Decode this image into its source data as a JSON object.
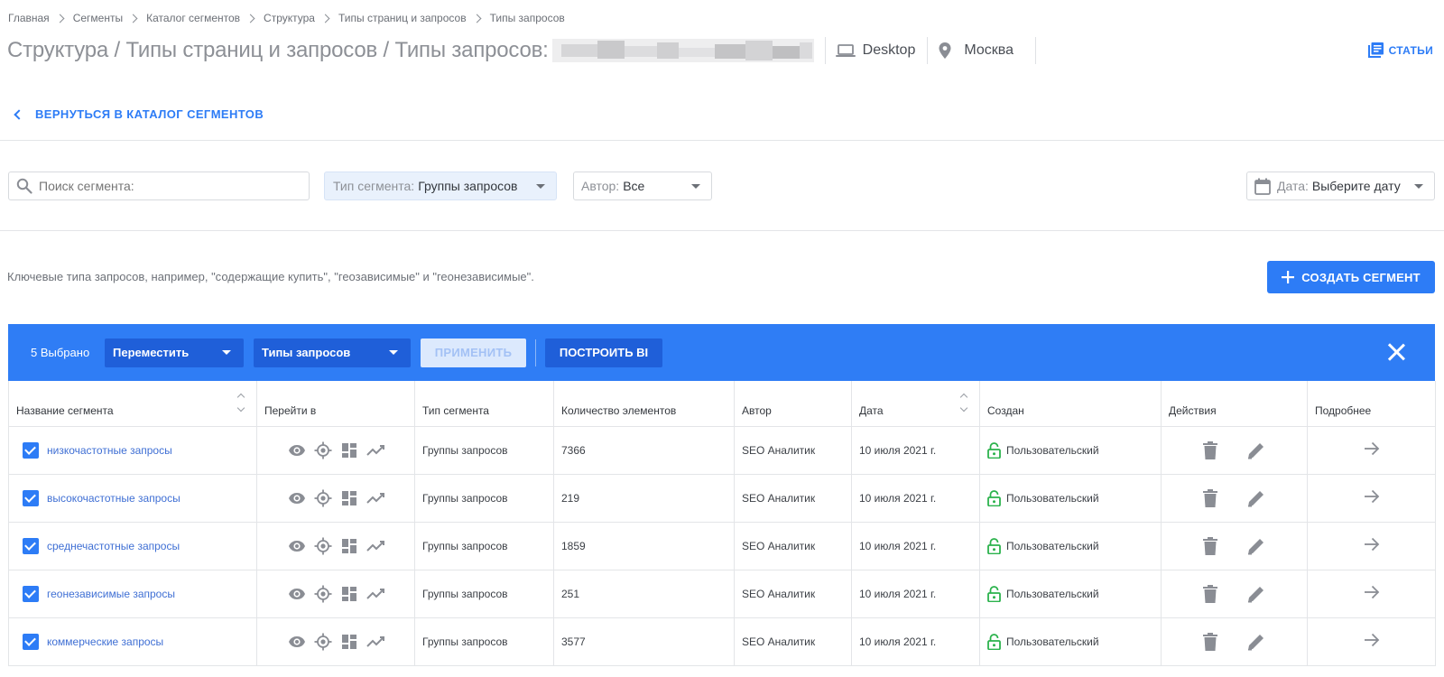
{
  "breadcrumb": [
    "Главная",
    "Сегменты",
    "Каталог сегментов",
    "Структура",
    "Типы страниц и запросов",
    "Типы запросов"
  ],
  "header": {
    "title": "Структура / Типы страниц и запросов / Типы запросов:",
    "device": "Desktop",
    "region": "Москва",
    "articles_label": "СТАТЬИ"
  },
  "back_link": "ВЕРНУТЬСЯ В КАТАЛОГ СЕГМЕНТОВ",
  "filters": {
    "search_placeholder": "Поиск сегмента:",
    "segment_type_label": "Тип сегмента:",
    "segment_type_value": "Группы запросов",
    "author_label": "Автор:",
    "author_value": "Все",
    "date_label": "Дата:",
    "date_value": "Выберите дату"
  },
  "description": "Ключевые типа запросов, например, \"содержащие купить\", \"геозависимые\" и \"геонезависимые\".",
  "create_button": "СОЗДАТЬ СЕГМЕНТ",
  "bulk": {
    "selected_count": "5 Выбрано",
    "action_value": "Переместить",
    "target_value": "Типы запросов",
    "apply_label": "ПРИМЕНИТЬ",
    "build_bi_label": "ПОСТРОИТЬ BI"
  },
  "table": {
    "headers": {
      "name": "Название сегмента",
      "goto": "Перейти в",
      "type": "Тип сегмента",
      "count": "Количество элементов",
      "author": "Автор",
      "date": "Дата",
      "created": "Создан",
      "actions": "Действия",
      "details": "Подробнее"
    },
    "rows": [
      {
        "name": "низкочастотные запросы",
        "type": "Группы запросов",
        "count": "7366",
        "author": "SEO Аналитик",
        "date": "10 июля 2021 г.",
        "created": "Пользовательский"
      },
      {
        "name": "высокочастотные запросы",
        "type": "Группы запросов",
        "count": "219",
        "author": "SEO Аналитик",
        "date": "10 июля 2021 г.",
        "created": "Пользовательский"
      },
      {
        "name": "среднечастотные запросы",
        "type": "Группы запросов",
        "count": "1859",
        "author": "SEO Аналитик",
        "date": "10 июля 2021 г.",
        "created": "Пользовательский"
      },
      {
        "name": "геонезависимые запросы",
        "type": "Группы запросов",
        "count": "251",
        "author": "SEO Аналитик",
        "date": "10 июля 2021 г.",
        "created": "Пользовательский"
      },
      {
        "name": "коммерческие запросы",
        "type": "Группы запросов",
        "count": "3577",
        "author": "SEO Аналитик",
        "date": "10 июля 2021 г.",
        "created": "Пользовательский"
      }
    ]
  },
  "colors": {
    "accent": "#2d7cf6",
    "bulk_bar": "#2f7df5",
    "bulk_control": "#1f5fd9",
    "lock_green": "#2bb24c",
    "icon_grey": "#8a8d94"
  }
}
